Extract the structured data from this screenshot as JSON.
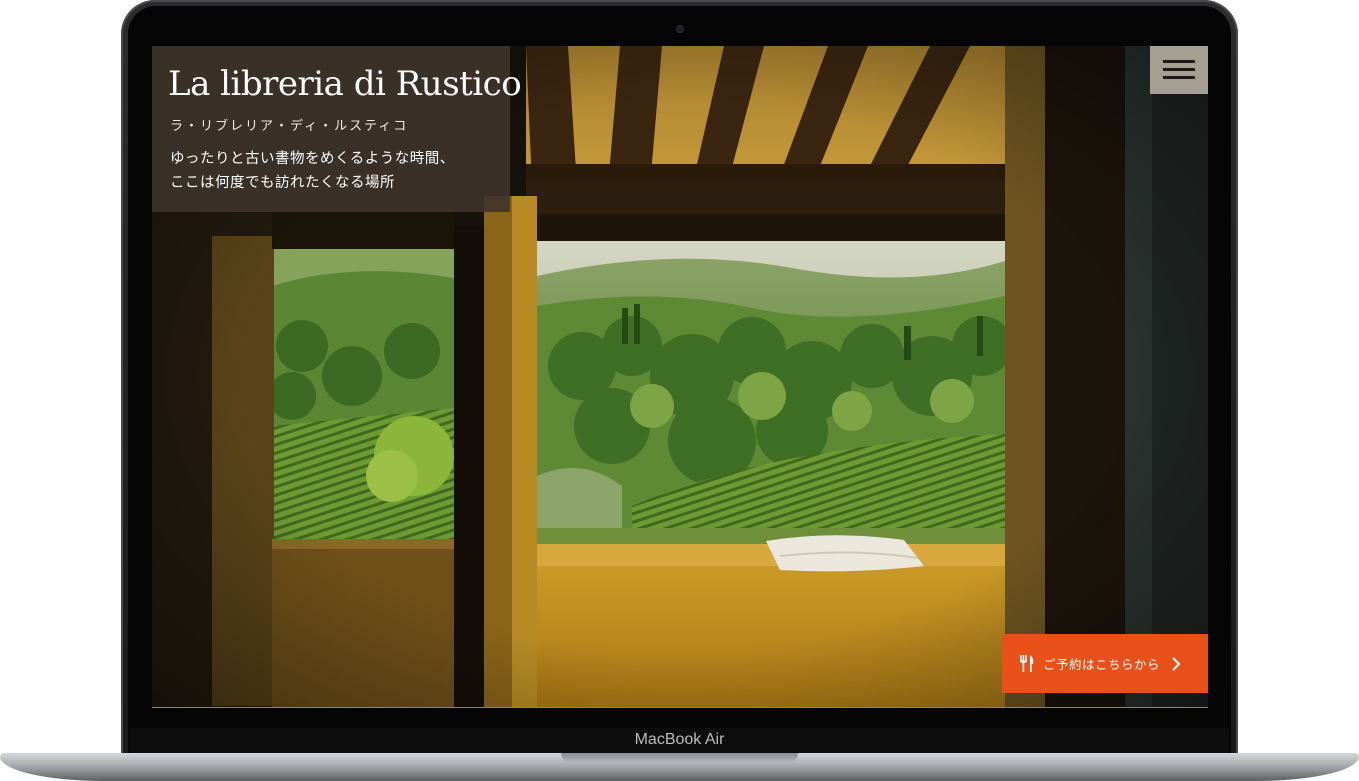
{
  "hero": {
    "title": "La libreria di Rustico",
    "subtitle": "ラ・リブレリア・ディ・ルスティコ",
    "tagline_lines": [
      "ゆったりと古い書物をめくるような時間、",
      "ここは何度でも訪れたくなる場所"
    ]
  },
  "header": {
    "menu_icon": "hamburger-menu-icon"
  },
  "cta": {
    "label": "ご予約はこちらから",
    "icon": "fork-knife-icon",
    "arrow_icon": "chevron-right-icon",
    "color": "#e9511a"
  },
  "device": {
    "label": "MacBook Air"
  },
  "colors": {
    "hero_card": "#3e342b",
    "menu_button": "#a39f93",
    "wall": "#c8941f"
  }
}
